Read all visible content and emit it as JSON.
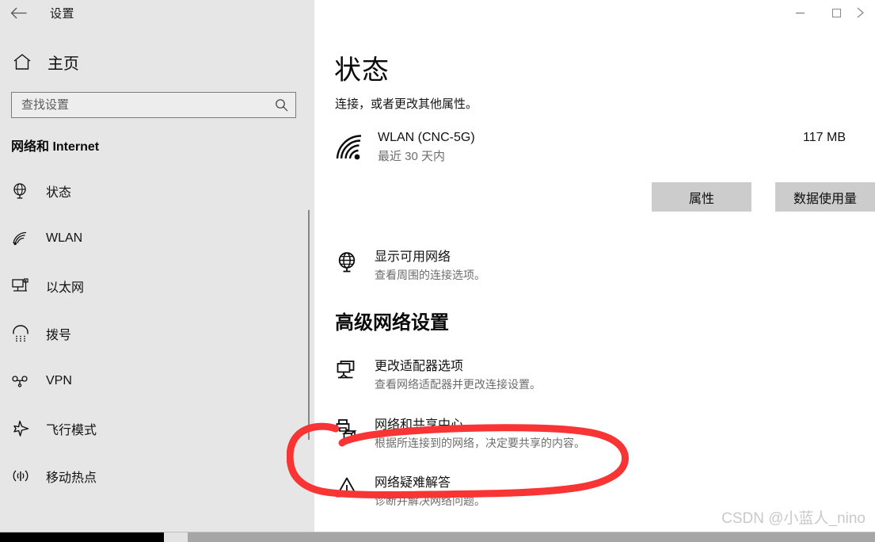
{
  "window": {
    "title": "设置",
    "back_label": "返回",
    "controls": {
      "minimize": "最小化",
      "maximize": "最大化",
      "close": "关闭"
    }
  },
  "sidebar": {
    "home": {
      "label": "主页",
      "icon": "home-icon"
    },
    "search": {
      "placeholder": "查找设置",
      "value": "",
      "icon": "search-icon"
    },
    "category": "网络和 Internet",
    "items": [
      {
        "label": "状态",
        "icon": "globe-status-icon"
      },
      {
        "label": "WLAN",
        "icon": "wifi-icon"
      },
      {
        "label": "以太网",
        "icon": "ethernet-icon"
      },
      {
        "label": "拨号",
        "icon": "dialup-icon"
      },
      {
        "label": "VPN",
        "icon": "vpn-icon"
      },
      {
        "label": "飞行模式",
        "icon": "airplane-icon"
      },
      {
        "label": "移动热点",
        "icon": "hotspot-icon"
      }
    ]
  },
  "main": {
    "title": "状态",
    "subtitle": "连接，或者更改其他属性。",
    "connection": {
      "name": "WLAN (CNC-5G)",
      "sub": "最近 30 天内",
      "usage": "117 MB",
      "icon": "wifi-signal-icon"
    },
    "buttons": {
      "properties": "属性",
      "data_usage": "数据使用量"
    },
    "show_networks": {
      "title": "显示可用网络",
      "desc": "查看周围的连接选项。",
      "icon": "globe-icon"
    },
    "advanced_heading": "高级网络设置",
    "advanced_items": [
      {
        "title": "更改适配器选项",
        "desc": "查看网络适配器并更改连接设置。",
        "icon": "monitor-adapter-icon"
      },
      {
        "title": "网络和共享中心",
        "desc": "根据所连接到的网络，决定要共享的内容。",
        "icon": "share-center-icon"
      },
      {
        "title": "网络疑难解答",
        "desc": "诊断并解决网络问题。",
        "icon": "warning-triangle-icon"
      }
    ]
  },
  "annotation": {
    "shape": "hand-drawn-ellipse",
    "color": "#f83434",
    "targets": "网络和共享中心"
  },
  "watermark": "CSDN @小蓝人_nino",
  "colors": {
    "sidebar_bg": "#e6e6e6",
    "content_bg": "#ffffff",
    "button_bg": "#cccccc",
    "annotation_red": "#f83434",
    "muted_text": "#6d6d6d"
  }
}
